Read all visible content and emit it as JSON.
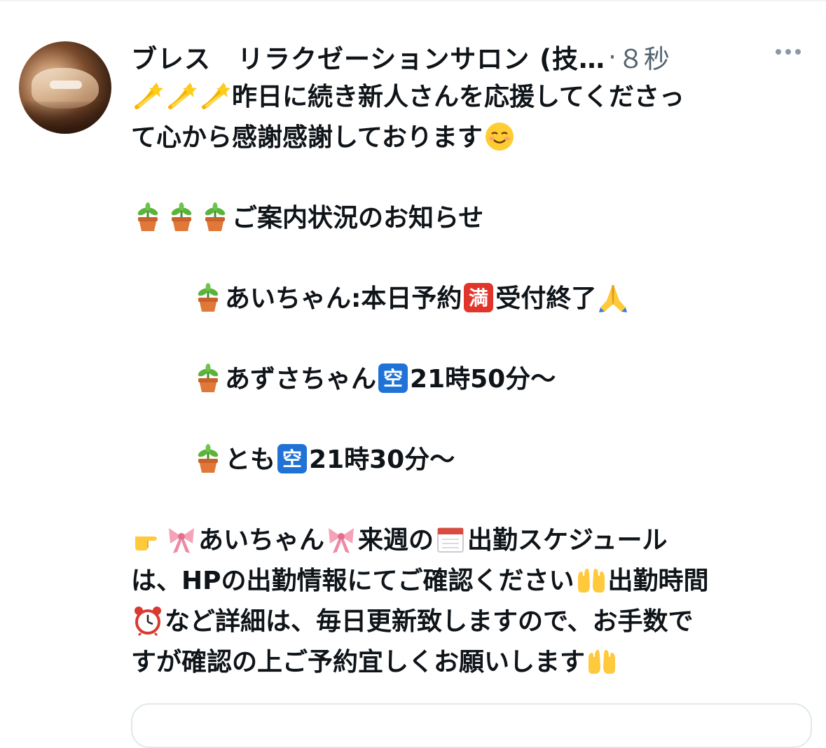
{
  "post": {
    "author": "ブレス　リラクゼーションサロン (技…",
    "separator": "·",
    "time": "８秒",
    "lines": [
      "昨日に続き新人さんを応援してくださっ",
      "て心から感謝感謝しております",
      "ご案内状況のお知らせ",
      "あいちゃん:本日予約",
      "受付終了",
      "あずさちゃん",
      "21時50分〜",
      "とも",
      "21時30分〜",
      "あいちゃん",
      "来週の",
      "出勤スケジュール",
      "は、HPの出勤情報にてご確認ください",
      "出勤時間",
      "など詳細は、毎日更新致しますので、お手数で",
      "すが確認の上ご予約宜しくお願いします"
    ]
  },
  "icons": {
    "comet": "dizzy-icon",
    "plant": "potted-plant-icon",
    "full": "full-sign-icon",
    "vacant": "vacant-sign-icon",
    "pray": "folded-hands-icon",
    "pointer": "pointing-hand-icon",
    "ribbon": "ribbon-icon",
    "calendar": "calendar-icon",
    "raised_hands": "palms-up-icon",
    "clock": "alarm-clock-icon",
    "smile": "smiling-face-icon",
    "more": "more-icon"
  },
  "colors": {
    "text": "#0f1419",
    "secondary": "#536471",
    "full_badge": "#e0352b",
    "vacant_badge": "#1f72d6"
  },
  "badges": {
    "full": "満",
    "vacant": "空"
  }
}
